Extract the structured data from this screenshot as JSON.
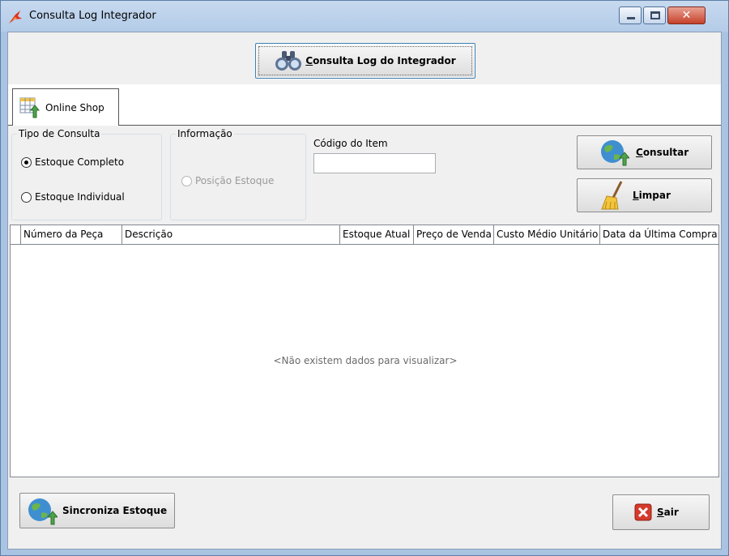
{
  "window": {
    "title": "Consulta Log Integrador",
    "close_glyph": "✕"
  },
  "toolbar": {
    "consulta_log_mnemonic": "C",
    "consulta_log_rest": "onsulta Log do Integrador"
  },
  "tabs": [
    {
      "label": "Online Shop",
      "icon": "grid-upload-icon",
      "selected": true
    }
  ],
  "filters": {
    "tipo_de_consulta": {
      "legend": "Tipo de Consulta",
      "options": [
        {
          "label": "Estoque Completo",
          "checked": true
        },
        {
          "label": "Estoque Individual",
          "checked": false
        }
      ]
    },
    "informacao": {
      "legend": "Informação",
      "options": [
        {
          "label": "Posição Estoque",
          "checked": false,
          "disabled": true
        }
      ]
    },
    "codigo_do_item": {
      "label": "Código do Item",
      "value": ""
    }
  },
  "actions": {
    "consultar_mnemonic": "C",
    "consultar_rest": "onsultar",
    "limpar_mnemonic": "L",
    "limpar_rest": "impar"
  },
  "grid": {
    "columns": [
      "Número da Peça",
      "Descrição",
      "Estoque Atual",
      "Preço de Venda",
      "Custo Médio Unitário",
      "Data da Última Compra"
    ],
    "rows": [],
    "empty_message": "<Não existem dados para visualizar>"
  },
  "footer": {
    "sincroniza_label": "Sincroniza Estoque",
    "sair_mnemonic": "S",
    "sair_rest": "air"
  },
  "colors": {
    "window_frame": "#a9c4e2",
    "client_bg": "#f0f0f0",
    "close_button": "#c6412a",
    "focus_border": "#3c7fb1"
  }
}
